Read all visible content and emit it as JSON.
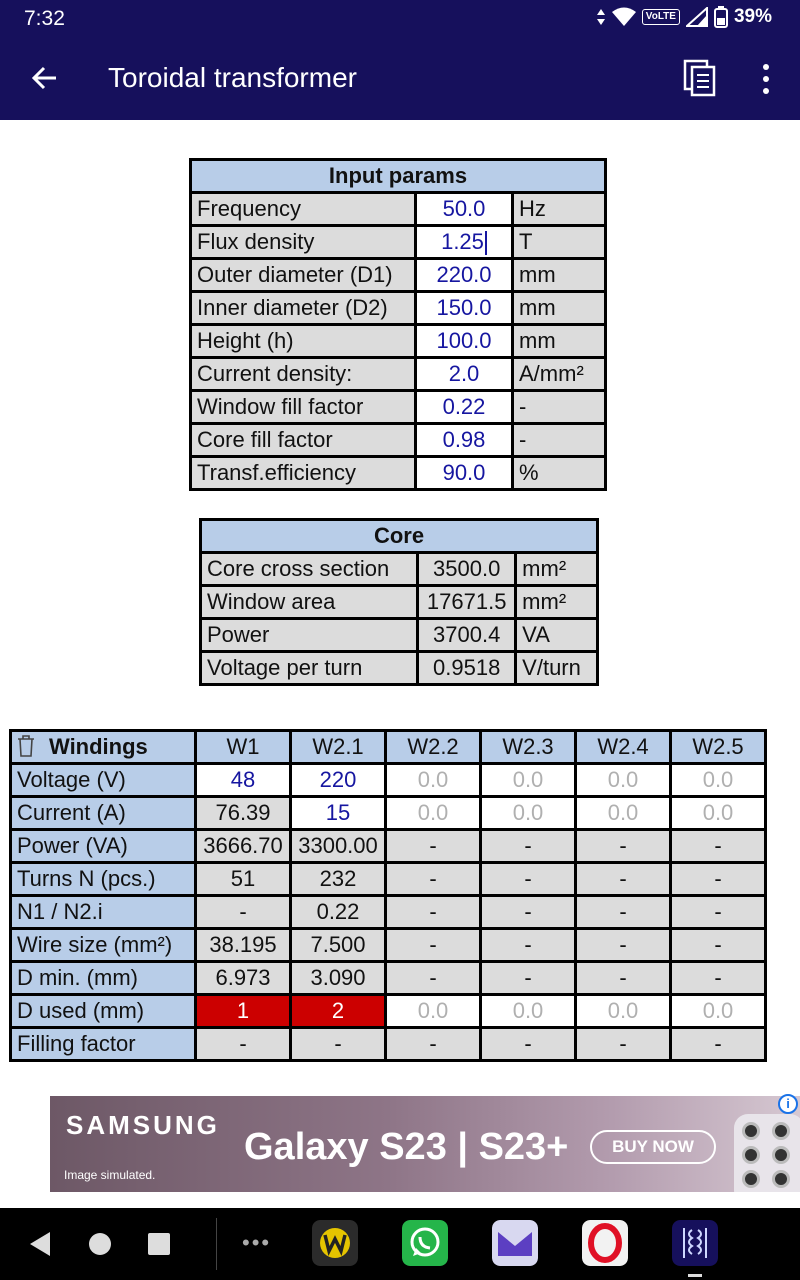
{
  "status": {
    "time": "7:32",
    "network": "VoLTE",
    "battery": "39%"
  },
  "appbar": {
    "title": "Toroidal transformer"
  },
  "input": {
    "header": "Input params",
    "rows": [
      {
        "label": "Frequency",
        "value": "50.0",
        "unit": "Hz"
      },
      {
        "label": "Flux density",
        "value": "1.25",
        "unit": "T"
      },
      {
        "label": "Outer diameter (D1)",
        "value": "220.0",
        "unit": "mm"
      },
      {
        "label": "Inner diameter (D2)",
        "value": "150.0",
        "unit": "mm"
      },
      {
        "label": "Height (h)",
        "value": "100.0",
        "unit": "mm"
      },
      {
        "label": "Current density:",
        "value": "2.0",
        "unit": "A/mm²"
      },
      {
        "label": "Window fill factor",
        "value": "0.22",
        "unit": "-"
      },
      {
        "label": "Core fill factor",
        "value": "0.98",
        "unit": "-"
      },
      {
        "label": "Transf.efficiency",
        "value": "90.0",
        "unit": "%"
      }
    ]
  },
  "core": {
    "header": "Core",
    "rows": [
      {
        "label": "Core cross section",
        "value": "3500.0",
        "unit": "mm²"
      },
      {
        "label": "Window area",
        "value": "17671.5",
        "unit": "mm²"
      },
      {
        "label": "Power",
        "value": "3700.4",
        "unit": "VA"
      },
      {
        "label": "Voltage per turn",
        "value": "0.9518",
        "unit": "V/turn"
      }
    ]
  },
  "windings": {
    "header": "Windings",
    "columns": [
      "W1",
      "W2.1",
      "W2.2",
      "W2.3",
      "W2.4",
      "W2.5"
    ],
    "rows": [
      {
        "label": "Voltage (V)",
        "cells": [
          "48",
          "220",
          "0.0",
          "0.0",
          "0.0",
          "0.0"
        ]
      },
      {
        "label": "Current (A)",
        "cells": [
          "76.39",
          "15",
          "0.0",
          "0.0",
          "0.0",
          "0.0"
        ]
      },
      {
        "label": "Power (VA)",
        "cells": [
          "3666.70",
          "3300.00",
          "-",
          "-",
          "-",
          "-"
        ]
      },
      {
        "label": "Turns N (pcs.)",
        "cells": [
          "51",
          "232",
          "-",
          "-",
          "-",
          "-"
        ]
      },
      {
        "label": "N1 / N2.i",
        "cells": [
          "-",
          "0.22",
          "-",
          "-",
          "-",
          "-"
        ]
      },
      {
        "label": "Wire size (mm²)",
        "cells": [
          "38.195",
          "7.500",
          "-",
          "-",
          "-",
          "-"
        ]
      },
      {
        "label": "D min. (mm)",
        "cells": [
          "6.973",
          "3.090",
          "-",
          "-",
          "-",
          "-"
        ]
      },
      {
        "label": "D used (mm)",
        "cells": [
          "1",
          "2",
          "0.0",
          "0.0",
          "0.0",
          "0.0"
        ]
      },
      {
        "label": "Filling factor",
        "cells": [
          "-",
          "-",
          "-",
          "-",
          "-",
          "-"
        ]
      }
    ]
  },
  "ad": {
    "brand": "SAMSUNG",
    "product": "Galaxy S23 | S23+",
    "cta": "BUY NOW",
    "disclaimer": "Image simulated.",
    "info": "i"
  },
  "nav": {
    "more": "•••"
  },
  "colors": {
    "appbar": "#16105c",
    "header_cell": "#b8cde8",
    "input_text": "#1616a0",
    "warning_cell": "#cc0000"
  }
}
